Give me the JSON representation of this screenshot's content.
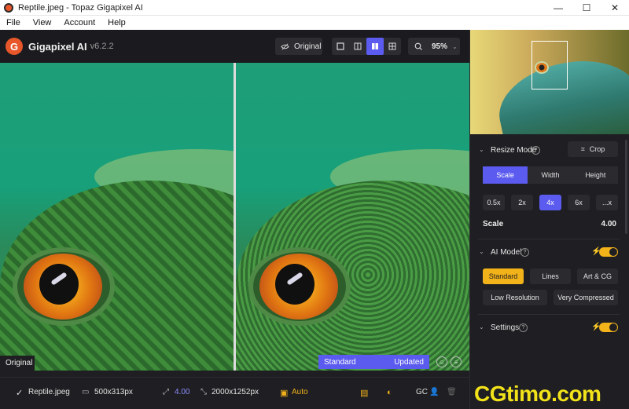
{
  "window": {
    "title": "Reptile.jpeg - Topaz Gigapixel AI",
    "controls": [
      "—",
      "☐",
      "✕"
    ]
  },
  "menu": [
    "File",
    "View",
    "Account",
    "Help"
  ],
  "app": {
    "logo_letter": "G",
    "name": "Gigapixel AI",
    "version": "v6.2.2"
  },
  "toolbar": {
    "original_label": "Original",
    "zoom": "95%",
    "active_view": "side-by-side"
  },
  "preview": {
    "original_label": "Original",
    "model_label": "Standard",
    "status_label": "Updated"
  },
  "status": {
    "file_name": "Reptile.jpeg",
    "input_size": "500x313px",
    "scale": "4.00",
    "output_size": "2000x1252px",
    "auto_label": "Auto",
    "gc_label": "GC"
  },
  "panel": {
    "resize_mode": {
      "title": "Resize Mode",
      "crop_label": "Crop",
      "modes": [
        "Scale",
        "Width",
        "Height"
      ],
      "active_mode": "Scale",
      "presets": [
        "0.5x",
        "2x",
        "4x",
        "6x",
        "...x"
      ],
      "active_preset": "4x",
      "scale_label": "Scale",
      "scale_value": "4.00"
    },
    "ai_model": {
      "title": "AI Model",
      "models": [
        "Standard",
        "Lines",
        "Art & CG",
        "Low Resolution",
        "Very Compressed"
      ],
      "active_model": "Standard",
      "enabled": true
    },
    "settings": {
      "title": "Settings",
      "enabled": true
    }
  },
  "watermark": "CGtimo.com",
  "colors": {
    "accent_blue": "#5b5bf0",
    "accent_yellow": "#f2b21a",
    "panel_bg": "#1f1f23"
  }
}
